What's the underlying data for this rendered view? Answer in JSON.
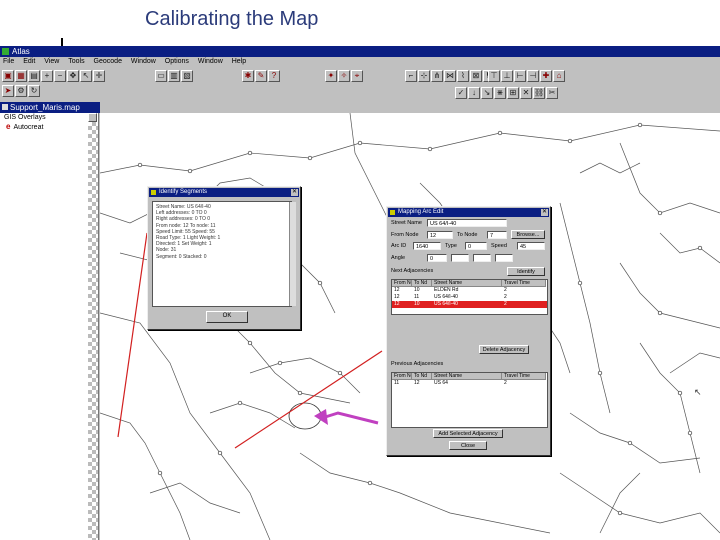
{
  "slide": {
    "title": "Calibrating the Map"
  },
  "app": {
    "title": "Atlas",
    "menu": [
      "File",
      "Edit",
      "View",
      "Tools",
      "Geocode",
      "Window",
      "Options",
      "Window",
      "Help"
    ]
  },
  "document": {
    "title": "Support_Maris.map"
  },
  "sidebar": {
    "header": "GIS Overlays",
    "items": [
      {
        "label": "Autocreat"
      }
    ]
  },
  "identify_dialog": {
    "title": "Identify Segments",
    "lines": [
      "Street Name: US 64/I-40",
      "Left addresses: 0 TO 0",
      "Right addresses: 0 TO 0",
      "From node: 12   To node: 11",
      "Speed Limit: 55   Speed: 55",
      "Road Type: 1   Light Weight: 1",
      "Directed: 1   Set Weight: 1",
      "Node: 31",
      "Segment: 0   Stacked: 0"
    ],
    "button": "OK"
  },
  "mapping_dialog": {
    "title": "Mapping Arc Edit",
    "street_name_label": "Street Name",
    "street_name_value": "US 64/I-40",
    "from_node_label": "From Node",
    "from_node_value": "12",
    "to_node_label": "To Node",
    "to_node_value": "7",
    "button_top": "Browse...",
    "arc_id_label": "Arc ID",
    "arc_id_value": "1640",
    "type_label": "Type",
    "type_value": "0",
    "speed_label": "Speed",
    "speed_value": "45",
    "angle_label": "Angle",
    "angle_value": "0",
    "adjacencies_label": "Next Adjacencies",
    "identify_button": "Identify",
    "table1": {
      "headers": [
        "From Nd",
        "To Nd",
        "Street Name",
        "Travel Time"
      ],
      "rows": [
        [
          "12",
          "10",
          "ELDEN Rd",
          "2"
        ],
        [
          "12",
          "11",
          "US 64/I-40",
          "2"
        ],
        [
          "12",
          "10",
          "US 64/I-40",
          "2"
        ]
      ],
      "selected_row": 2
    },
    "delete_button": "Delete Adjacency",
    "prev_label": "Previous Adjacencies",
    "table2": {
      "headers": [
        "From Nd",
        "To Nd",
        "Street Name",
        "Travel Time"
      ],
      "rows": [
        [
          "11",
          "12",
          "US 64",
          "2"
        ]
      ]
    },
    "add_button": "Add Selected Adjacency",
    "close_button": "Close"
  },
  "colors": {
    "titlebar": "#0a1e82",
    "selection": "#e02020",
    "annotation_arrow": "#d22020",
    "callout_arrow": "#c040c0"
  }
}
